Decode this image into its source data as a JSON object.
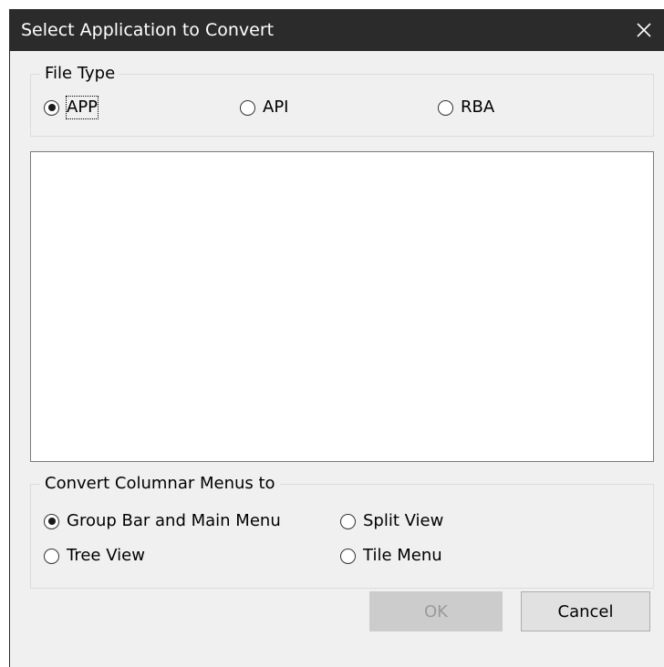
{
  "window": {
    "title": "Select Application to Convert",
    "close_icon": "close-icon"
  },
  "file_type": {
    "legend": "File Type",
    "options": [
      {
        "label": "APP",
        "selected": true,
        "focused": true
      },
      {
        "label": "API",
        "selected": false
      },
      {
        "label": "RBA",
        "selected": false
      }
    ]
  },
  "application_list": {
    "items": []
  },
  "columnar_menus": {
    "legend": "Convert Columnar Menus to",
    "options": [
      {
        "label": "Group Bar and Main Menu",
        "selected": true
      },
      {
        "label": "Split View",
        "selected": false
      },
      {
        "label": "Tree View",
        "selected": false
      },
      {
        "label": "Tile Menu",
        "selected": false
      }
    ]
  },
  "buttons": {
    "ok_label": "OK",
    "ok_enabled": false,
    "cancel_label": "Cancel"
  },
  "colors": {
    "titlebar": "#2b2b2b",
    "dialog_background": "#f0f0f0",
    "disabled_button": "#cccccc"
  }
}
